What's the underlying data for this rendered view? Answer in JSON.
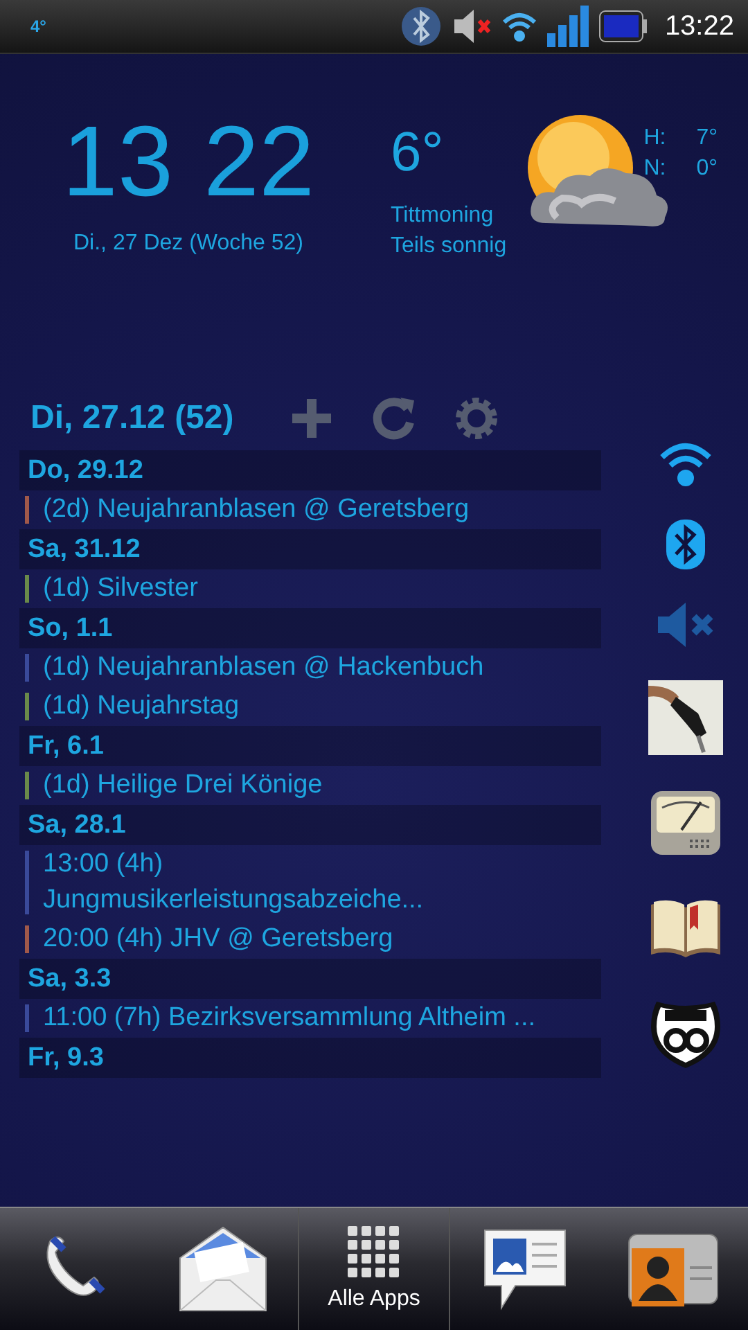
{
  "status_bar": {
    "temperature": "4°",
    "time": "13:22",
    "sound_muted": true
  },
  "clock_widget": {
    "hours": "13",
    "minutes": "22",
    "date": "Di., 27 Dez (Woche 52)"
  },
  "weather_widget": {
    "temperature": "6°",
    "location": "Tittmoning",
    "condition": "Teils sonnig",
    "high_label": "H:",
    "high": "7°",
    "low_label": "N:",
    "low": "0°"
  },
  "agenda": {
    "title": "Di, 27.12 (52)",
    "entries": [
      {
        "kind": "day",
        "text": "Do, 29.12"
      },
      {
        "kind": "event",
        "text": "(2d) Neujahranblasen @ Geretsberg",
        "color": "#a0584a"
      },
      {
        "kind": "day",
        "text": "Sa, 31.12"
      },
      {
        "kind": "event",
        "text": "(1d) Silvester",
        "color": "#6a8a4a"
      },
      {
        "kind": "day",
        "text": "So, 1.1"
      },
      {
        "kind": "event",
        "text": "(1d) Neujahranblasen @ Hackenbuch",
        "color": "#3a4a9a"
      },
      {
        "kind": "event",
        "text": "(1d) Neujahrstag",
        "color": "#6a8a4a"
      },
      {
        "kind": "day",
        "text": "Fr, 6.1"
      },
      {
        "kind": "event",
        "text": "(1d) Heilige Drei Könige",
        "color": "#6a8a4a"
      },
      {
        "kind": "day",
        "text": "Sa, 28.1"
      },
      {
        "kind": "event",
        "text": "13:00 (4h) Jungmusikerleistungsabzeiche...",
        "color": "#3a4a9a"
      },
      {
        "kind": "event",
        "text": "20:00 (4h) JHV @ Geretsberg",
        "color": "#a0584a"
      },
      {
        "kind": "day",
        "text": "Sa, 3.3"
      },
      {
        "kind": "event",
        "text": "11:00 (7h) Bezirksversammlung Altheim ...",
        "color": "#3a4a9a"
      },
      {
        "kind": "day",
        "text": "Fr, 9.3"
      }
    ]
  },
  "toggles": {
    "wifi_on": true,
    "bluetooth_on": true,
    "sound_muted": true
  },
  "dock": {
    "apps_label": "Alle Apps"
  }
}
